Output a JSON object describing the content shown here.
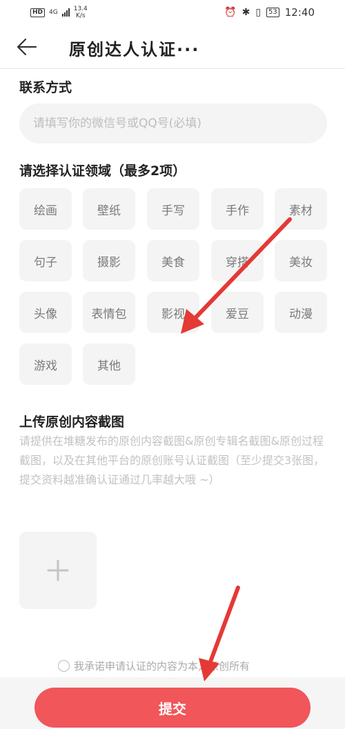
{
  "status_bar": {
    "hd": "HD",
    "network": "4G",
    "speed_value": "13.4",
    "speed_unit": "K/s",
    "battery": "53",
    "time": "12:40",
    "icons": [
      "alarm-icon",
      "bluetooth-icon",
      "vibrate-icon",
      "battery-icon"
    ]
  },
  "header": {
    "title": "原创达人认证···",
    "back_icon": "arrow-left-icon"
  },
  "contact": {
    "title": "联系方式",
    "placeholder": "请填写你的微信号或QQ号(必填)",
    "value": ""
  },
  "domains": {
    "title": "请选择认证领域（最多2项）",
    "items": [
      "绘画",
      "壁纸",
      "手写",
      "手作",
      "素材",
      "句子",
      "摄影",
      "美食",
      "穿搭",
      "美妆",
      "头像",
      "表情包",
      "影视",
      "爱豆",
      "动漫",
      "游戏",
      "其他"
    ]
  },
  "upload": {
    "title": "上传原创内容截图",
    "desc": "请提供在堆糖发布的原创内容截图&原创专辑名截图&原创过程截图，以及在其他平台的原创账号认证截图（至少提交3张图，提交资料越准确认证通过几率越大哦 ~）",
    "add_icon": "plus-icon"
  },
  "agreement": {
    "text": "我承诺申请认证的内容为本人原创所有",
    "checked": false
  },
  "submit": {
    "label": "提交"
  },
  "colors": {
    "accent": "#f0565a",
    "arrow": "#e53935",
    "tag_bg": "#f4f4f4"
  }
}
